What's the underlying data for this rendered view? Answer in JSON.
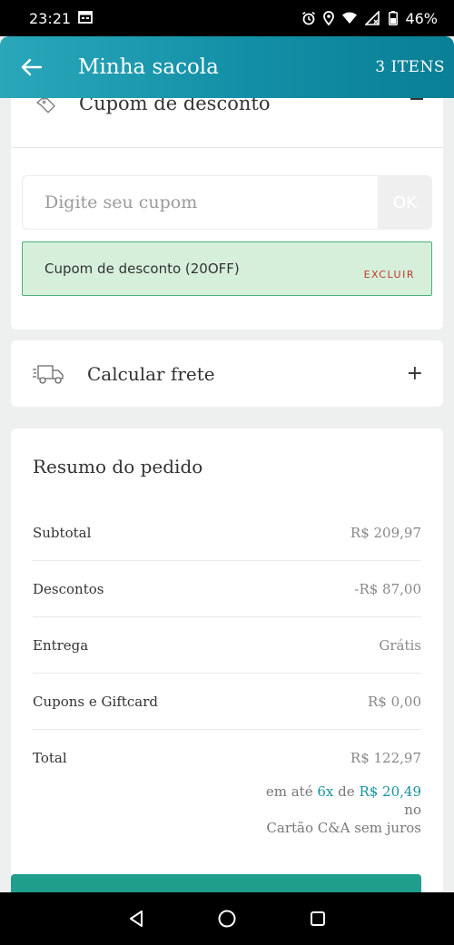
{
  "status_bar": {
    "time": "23:21",
    "battery": "46%"
  },
  "header": {
    "title": "Minha sacola",
    "items_count": "3 ITENS"
  },
  "coupon": {
    "title": "Cupom de desconto",
    "input_placeholder": "Digite seu cupom",
    "ok_label": "OK",
    "applied_text": "Cupom de desconto (20OFF)",
    "remove_label": "EXCLUIR"
  },
  "shipping": {
    "label": "Calcular frete"
  },
  "summary": {
    "title": "Resumo do pedido",
    "rows": [
      {
        "label": "Subtotal",
        "value": "R$ 209,97"
      },
      {
        "label": "Descontos",
        "value": "-R$ 87,00"
      },
      {
        "label": "Entrega",
        "value": "Grátis"
      },
      {
        "label": "Cupons e Giftcard",
        "value": "R$ 0,00"
      },
      {
        "label": "Total",
        "value": "R$ 122,97"
      }
    ],
    "installments": {
      "prefix": "em até",
      "count": "6x",
      "connector": "de",
      "amount": "R$ 20,49",
      "line2": "no",
      "line3": "Cartão C&A sem juros"
    }
  },
  "colors": {
    "accent": "#17939f",
    "applied_bg": "#d6efdb",
    "checkout": "#1f9e8b"
  }
}
